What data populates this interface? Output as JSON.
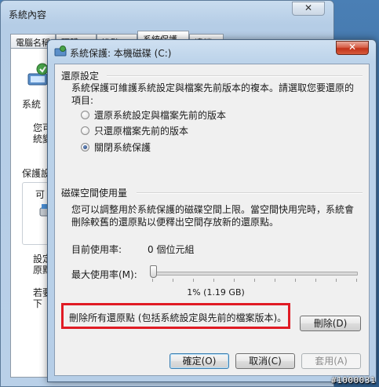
{
  "back_window": {
    "title": "系統內容",
    "tabs": [
      "電腦名稱",
      "硬體",
      "進階",
      "系統保護",
      "遠端"
    ],
    "fragments": {
      "system_frag": "系統",
      "frag_2a": "您可",
      "frag_2b": "統變",
      "protection_frag": "保護設",
      "available_frag": "可",
      "config_frag_a": "設定",
      "config_frag_b": "原點",
      "create_frag_a": "若要",
      "create_frag_b": "下"
    }
  },
  "dialog": {
    "title": "系統保護: 本機磁碟 (C:)",
    "restore_settings": {
      "heading": "還原設定",
      "description": "系統保護可維護系統設定與檔案先前版本的複本。請選取您要還原的項目:",
      "options": [
        {
          "label": "還原系統設定與檔案先前的版本",
          "checked": false
        },
        {
          "label": "只還原檔案先前的版本",
          "checked": false
        },
        {
          "label": "關閉系統保護",
          "checked": true
        }
      ]
    },
    "disk_usage": {
      "heading": "磁碟空間使用量",
      "description": "您可以調整用於系統保護的磁碟空間上限。當空間快用完時，系統會刪除較舊的還原點以便釋出空間存放新的還原點。",
      "current_label": "目前使用率:",
      "current_value": "0 個位元組",
      "max_label": "最大使用率(M):",
      "slider_value_text": "1% (1.19 GB)",
      "slider_percent": 1
    },
    "delete": {
      "label": "刪除所有還原點 (包括系統設定與先前的檔案版本)。",
      "button": "刪除(D)"
    },
    "buttons": {
      "ok": "確定(O)",
      "cancel": "取消(C)",
      "apply": "套用(A)"
    }
  },
  "close_glyph": "✕",
  "watermark": "#1000031",
  "colors": {
    "highlight_box": "#e01b24",
    "close_button": "#c2321a"
  }
}
